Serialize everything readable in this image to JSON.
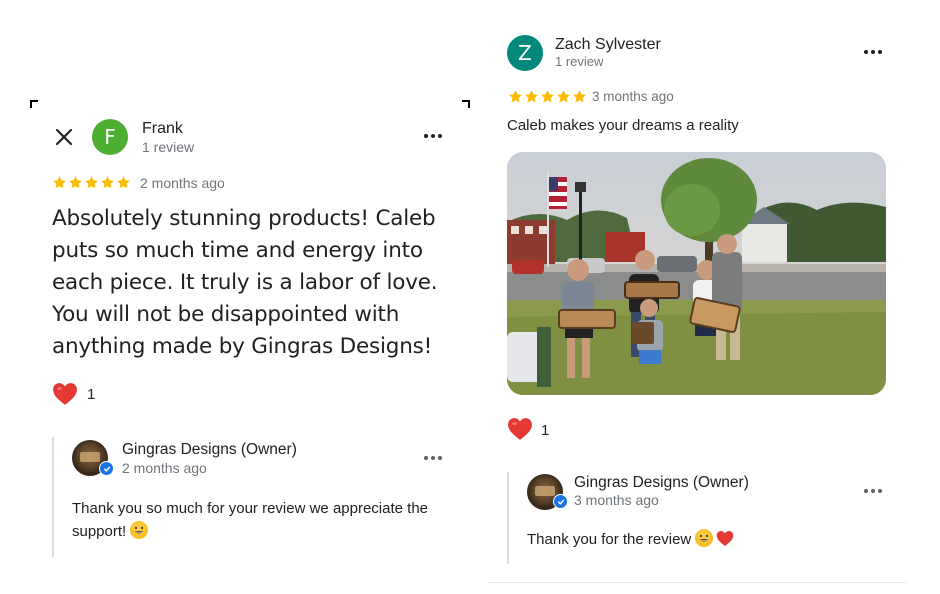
{
  "left_review": {
    "reviewer_name": "Frank",
    "reviewer_initial": "F",
    "reviewer_meta": "1 review",
    "rating": 5,
    "date": "2 months ago",
    "text": "Absolutely stunning products! Caleb puts so much time and energy into each piece. It truly is a labor of love. You will not be disappointed with anything made by Gingras Designs!",
    "reaction_count": "1",
    "owner_reply": {
      "name": "Gingras Designs (Owner)",
      "date": "2 months ago",
      "text": "Thank you so much for your review we appreciate the support!"
    }
  },
  "right_review": {
    "reviewer_name": "Zach Sylvester",
    "reviewer_initial": "Z",
    "reviewer_meta": "1 review",
    "rating": 5,
    "date": "3 months ago",
    "text": "Caleb makes your dreams a reality",
    "reaction_count": "1",
    "owner_reply": {
      "name": "Gingras Designs (Owner)",
      "date": "3 months ago",
      "text": "Thank you for the review"
    }
  },
  "colors": {
    "avatar_f": "#4caf32",
    "avatar_z": "#00897b",
    "star": "#fbbc04",
    "heart": "#e53935",
    "verified": "#1a73e8"
  },
  "icons": {
    "close": "close-icon",
    "more": "more-horizontal-icon",
    "star": "star-icon",
    "heart": "heart-icon",
    "verified": "verified-check-icon",
    "emoji": "grinning-face-emoji"
  }
}
